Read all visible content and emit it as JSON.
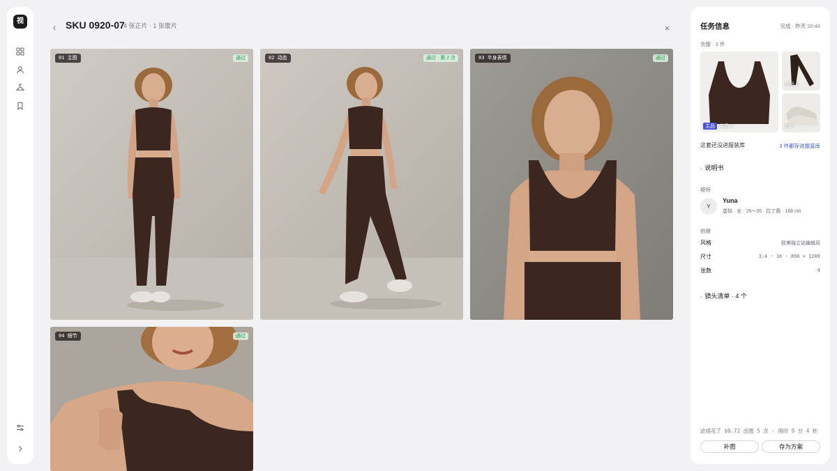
{
  "app": {
    "logo": "视"
  },
  "rail": {
    "icons": [
      "grid-icon",
      "person-icon",
      "hanger-icon",
      "bookmark-icon",
      "sliders-icon",
      "chevron-right-icon"
    ]
  },
  "header": {
    "title": "SKU 0920-07",
    "subtitle": "4 张正片 · 1 张废片"
  },
  "photos": [
    {
      "tag": "01 主图",
      "status": "通过"
    },
    {
      "tag": "02 动态",
      "status": "通过 · 第 2 次"
    },
    {
      "tag": "03 半身表情",
      "status": "通过"
    },
    {
      "tag": "04 细节",
      "status": "通过"
    }
  ],
  "panel": {
    "title": "任务信息",
    "meta": "完成 · 昨天 20:40",
    "clothing_label": "衣服 · 3 件",
    "items": [
      {
        "badge": "主品",
        "label": "单品 1"
      },
      {
        "label": "单品 2"
      },
      {
        "label": "鞋 3"
      }
    ],
    "wardrobe_note": "这套还没进服装库",
    "wardrobe_link": "3 件都存进服装库",
    "manual": "说明书",
    "model_label": "模特",
    "model": {
      "initial": "Y",
      "name": "Yuna",
      "desc": "虚拟 · 女 · 26～35 · 拉丁裔 · 168 cm"
    },
    "shoot_label": "拍摄",
    "specs": [
      {
        "key": "风格",
        "value": "欧美独立站编辑风"
      },
      {
        "key": "尺寸",
        "value": "3:4 · 1K · 896 × 1200"
      },
      {
        "key": "张数",
        "value": "4"
      }
    ],
    "shots": "镜头清单 · 4 个",
    "footer_note": "这组花了 $0.72  出图 5 次 · 用时 9 分 4 秒",
    "buttons": {
      "retouch": "补图",
      "save": "存为方案"
    }
  },
  "colors": {
    "accent": "#4b4fd8",
    "link": "#3c5bd6",
    "pass": "#2f9a55",
    "outfit": "#3b2620"
  }
}
